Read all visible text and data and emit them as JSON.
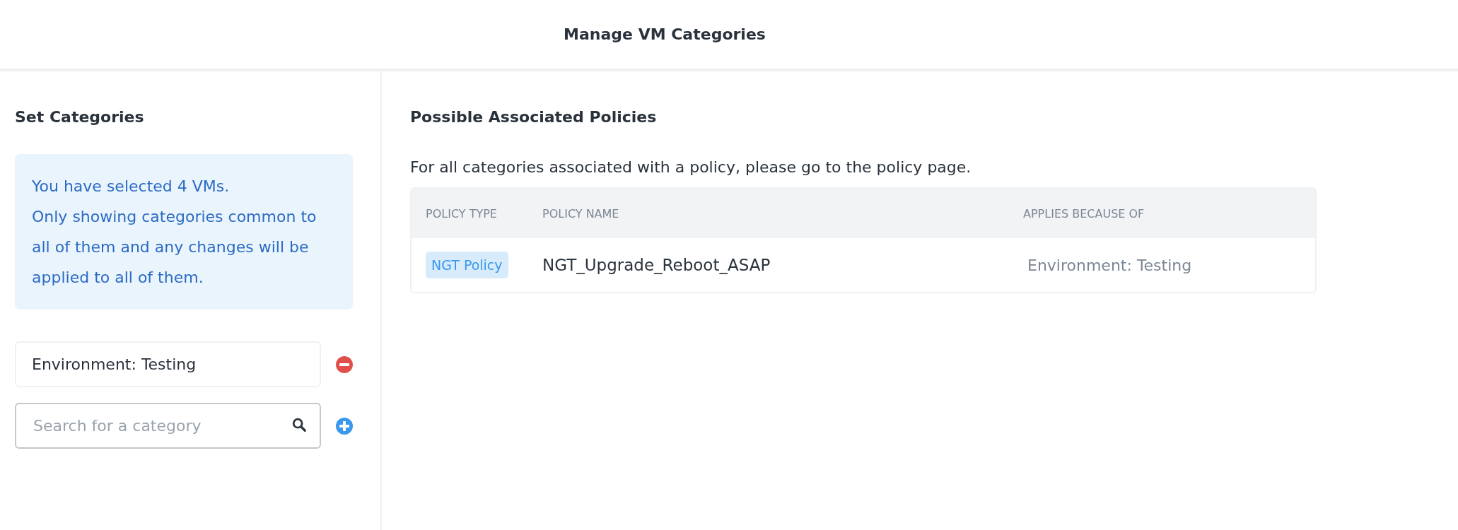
{
  "dialog": {
    "title": "Manage VM Categories"
  },
  "set_categories": {
    "heading": "Set Categories",
    "info": [
      "You have selected 4 VMs.",
      "Only showing categories common to all of them and any changes will be applied to all of them."
    ],
    "assigned": [
      {
        "value": "Environment: Testing"
      }
    ],
    "search": {
      "placeholder": "Search for a category"
    }
  },
  "policies": {
    "heading": "Possible Associated Policies",
    "description": "For all categories associated with a policy, please go to the policy page.",
    "columns": [
      "POLICY TYPE",
      "POLICY NAME",
      "APPLIES BECAUSE OF"
    ],
    "rows": [
      {
        "type": "NGT Policy",
        "name": "NGT_Upgrade_Reboot_ASAP",
        "reason": "Environment: Testing"
      }
    ]
  }
}
